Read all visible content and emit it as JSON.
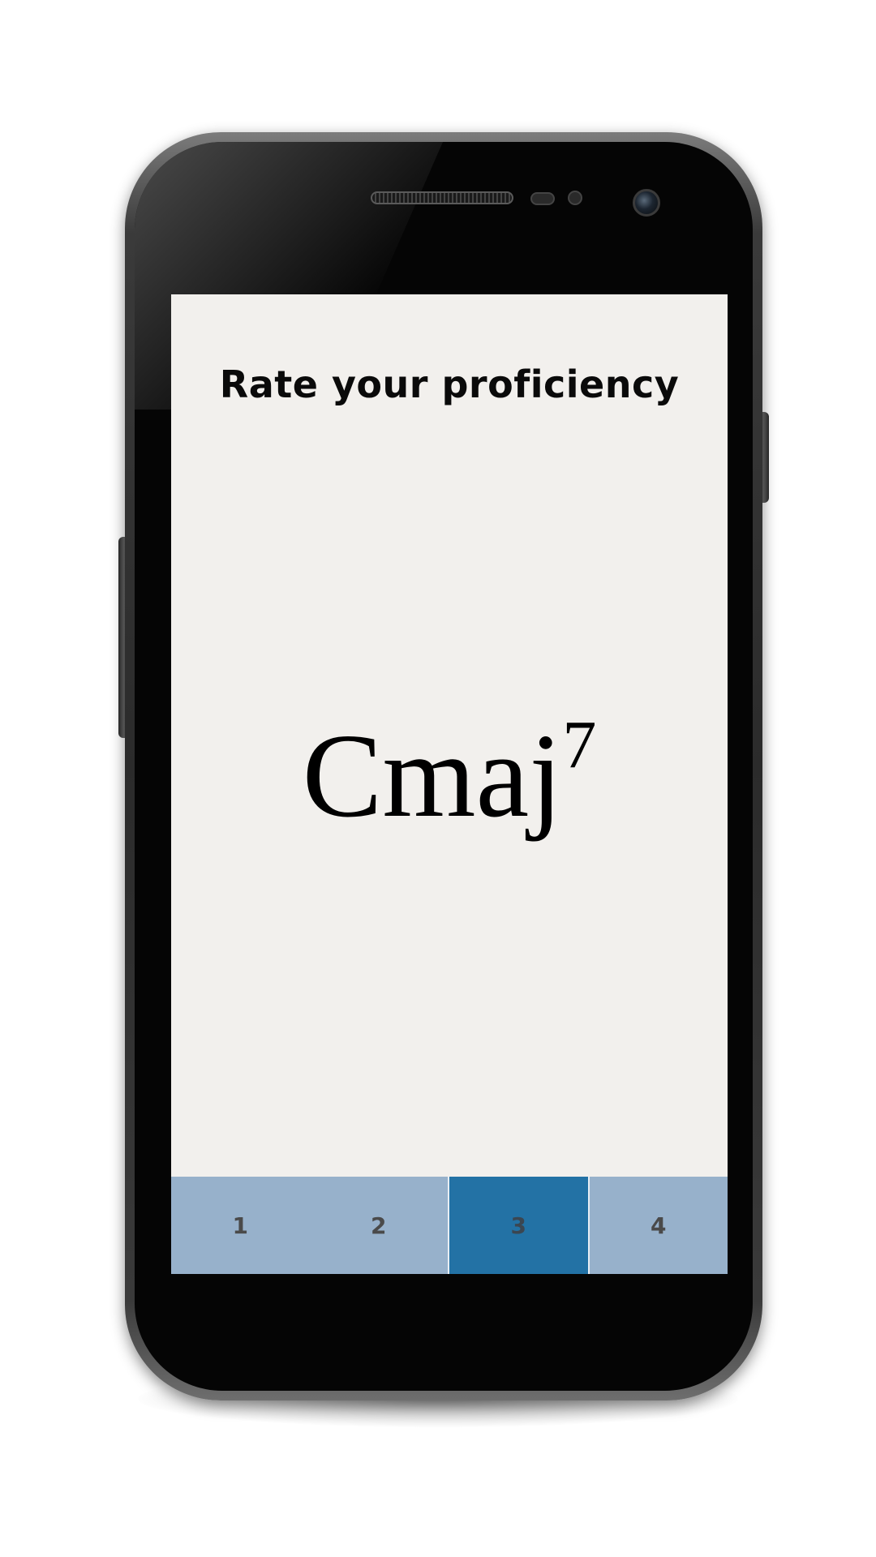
{
  "screen": {
    "title": "Rate your proficiency",
    "chord": {
      "root_quality": "Cmaj",
      "extension": "7"
    }
  },
  "rating": {
    "options": [
      {
        "label": "1",
        "selected": false
      },
      {
        "label": "2",
        "selected": false
      },
      {
        "label": "3",
        "selected": true
      },
      {
        "label": "4",
        "selected": false
      }
    ],
    "selected_value": "3"
  },
  "colors": {
    "screen_background": "#f2f0ed",
    "rating_bar": "#97b1cb",
    "rating_selected": "#2372a5",
    "phone_body": "#050505"
  }
}
